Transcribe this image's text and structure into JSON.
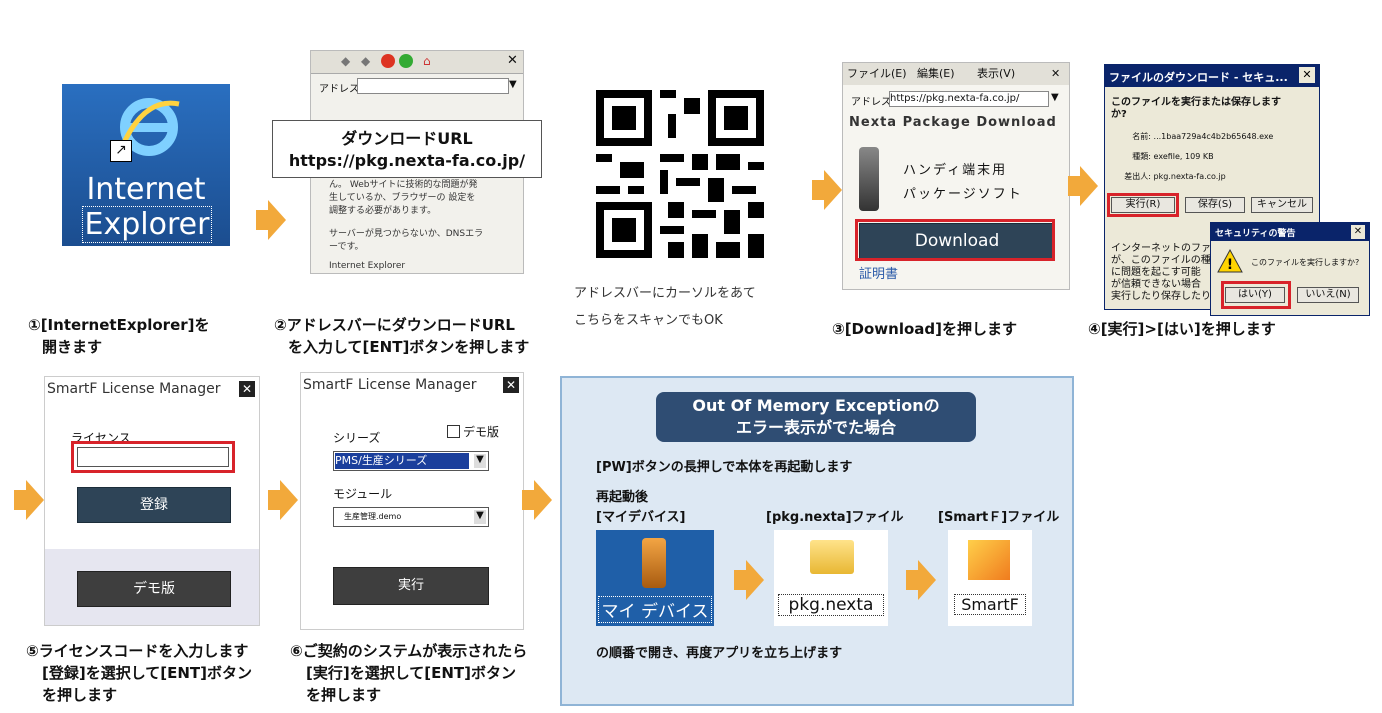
{
  "step1": {
    "icon_line1": "Internet",
    "icon_line2": "Explorer",
    "caption_line1": "①[InternetExplorer]を",
    "caption_line2": "開きます"
  },
  "step2": {
    "address_label": "アドレス",
    "callout_title": "ダウンロードURL",
    "callout_url": "https://pkg.nexta-fa.co.jp/",
    "error_text1": "ん。 Webサイトに技術的な問題が発",
    "error_text2": "生しているか、ブラウザーの 設定を",
    "error_text3": "調整する必要があります。",
    "error_text4": "サーバーが見つからないか、DNSエラ",
    "error_text5": "ーです。",
    "error_text6": "Internet Explorer",
    "caption_line1": "②アドレスバーにダウンロードURL",
    "caption_line2": "を入力して[ENT]ボタンを押します"
  },
  "qr": {
    "note_line1": "アドレスバーにカーソルをあて",
    "note_line2": "こちらをスキャンでもOK"
  },
  "step3": {
    "menu_file": "ファイル(E)",
    "menu_edit": "編集(E)",
    "menu_view": "表示(V)",
    "address_label": "アドレス",
    "address_url": "https://pkg.nexta-fa.co.jp/",
    "page_title": "Nexta Package Download",
    "desc_line1": "ハンディ端末用",
    "desc_line2": "パッケージソフト",
    "download_label": "Download",
    "cert_link": "証明書",
    "caption": "③[Download]を押します"
  },
  "step4": {
    "title": "ファイルのダウンロード - セキュ...",
    "question": "このファイルを実行または保存します",
    "question2": "か?",
    "name_label": "名前:",
    "name_value": "...1baa729a4c4b2b65648.exe",
    "type_label": "種類:",
    "type_value": "exefile, 109 KB",
    "from_label": "差出人:",
    "from_value": "pkg.nexta-fa.co.jp",
    "run_label": "実行(R)",
    "save_label": "保存(S)",
    "cancel_label": "キャンセル",
    "body1": "インターネットのファイ",
    "body2": "が、このファイルの種",
    "body3": "に問題を起こす可能",
    "body4": "が信頼できない場合",
    "body5": "実行したり保存したり",
    "warn_title": "セキュリティの警告",
    "warn_text": "このファイルを実行しますか?",
    "yes_label": "はい(Y)",
    "no_label": "いいえ(N)",
    "caption": "④[実行]>[はい]を押します"
  },
  "step5": {
    "title": "SmartF License Manager",
    "license_label": "ライセンス",
    "register_label": "登録",
    "demo_label": "デモ版",
    "caption_line1": "⑤ライセンスコードを入力します",
    "caption_line2": "[登録]を選択して[ENT]ボタン",
    "caption_line3": "を押します"
  },
  "step6": {
    "title": "SmartF License Manager",
    "series_label": "シリーズ",
    "demo_checkbox_label": "デモ版",
    "series_value": "PMS/生産シリーズ",
    "module_label": "モジュール",
    "module_value": "生産管理.demo",
    "run_label": "実行",
    "caption_line1": "⑥ご契約のシステムが表示されたら",
    "caption_line2": "[実行]を選択して[ENT]ボタン",
    "caption_line3": "を押します"
  },
  "oom": {
    "heading_line1": "Out Of Memory Exceptionの",
    "heading_line2": "エラー表示がでた場合",
    "instruction": "[PW]ボタンの長押しで本体を再起動します",
    "after_label": "再起動後",
    "device_label": "[マイデバイス]",
    "device_icon_text": "マイ デバイス",
    "pkg_label": "[pkg.nexta]ファイル",
    "pkg_icon_text": "pkg.nexta",
    "smartf_label": "[SmartＦ]ファイル",
    "smartf_icon_text": "SmartF",
    "footer": "の順番で開き、再度アプリを立ち上げます"
  },
  "colors": {
    "arrow": "#f2a93b",
    "button_dark": "#2e4457",
    "highlight_red": "#d8232a",
    "panel_bg": "#dde8f3",
    "panel_border": "#8fb4d6",
    "ie_blue": "#1f5fa8"
  }
}
